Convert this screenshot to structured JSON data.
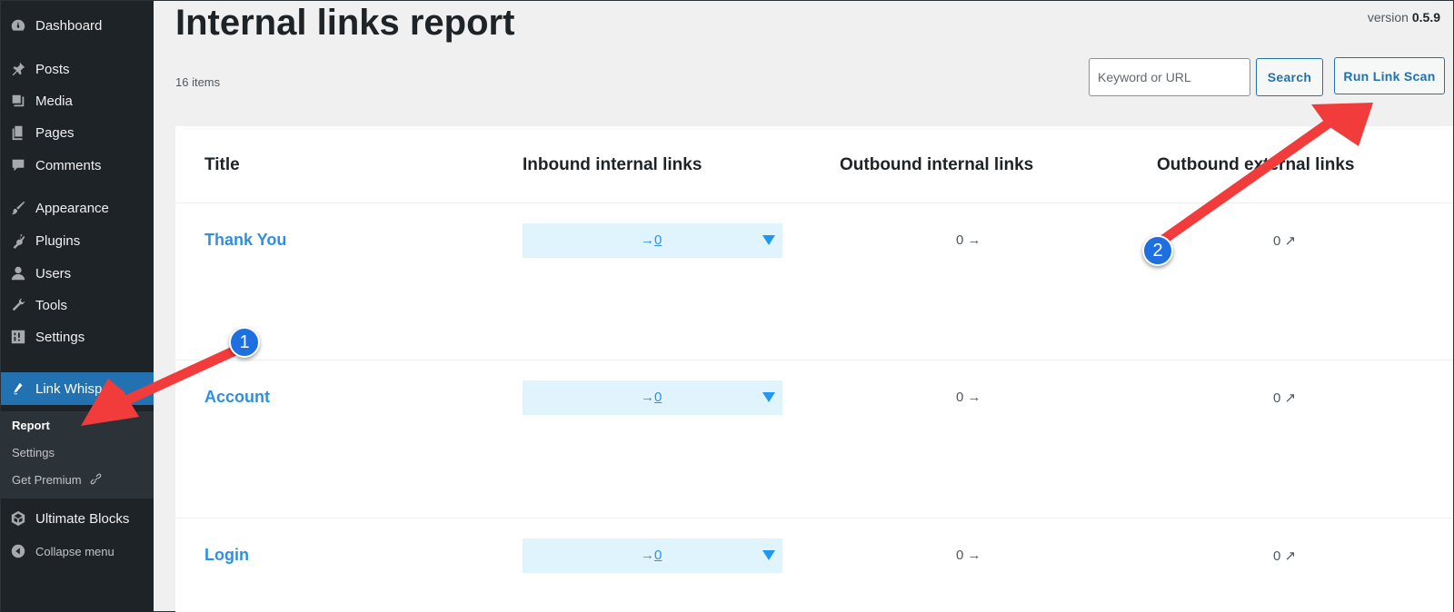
{
  "sidebar": {
    "items": [
      {
        "label": "Dashboard",
        "icon": "dashboard-icon"
      },
      {
        "label": "Posts",
        "icon": "pin-icon"
      },
      {
        "label": "Media",
        "icon": "media-icon"
      },
      {
        "label": "Pages",
        "icon": "pages-icon"
      },
      {
        "label": "Comments",
        "icon": "comment-icon"
      },
      {
        "label": "Appearance",
        "icon": "brush-icon"
      },
      {
        "label": "Plugins",
        "icon": "plugin-icon"
      },
      {
        "label": "Users",
        "icon": "user-icon"
      },
      {
        "label": "Tools",
        "icon": "wrench-icon"
      },
      {
        "label": "Settings",
        "icon": "settings-icon"
      },
      {
        "label": "Link Whisper",
        "icon": "link-whisper-icon"
      },
      {
        "label": "Ultimate Blocks",
        "icon": "blocks-icon"
      },
      {
        "label": "Collapse menu",
        "icon": "collapse-icon"
      }
    ],
    "submenu": [
      {
        "label": "Report"
      },
      {
        "label": "Settings"
      },
      {
        "label": "Get Premium"
      }
    ]
  },
  "page": {
    "title": "Internal links report",
    "version_label": "version",
    "version_number": "0.5.9",
    "items_count": "16 items"
  },
  "search": {
    "placeholder": "Keyword or URL",
    "value": "",
    "button_label": "Search"
  },
  "scan": {
    "button_label": "Run Link Scan"
  },
  "table": {
    "headers": [
      "Title",
      "Inbound internal links",
      "Outbound internal links",
      "Outbound external links"
    ],
    "rows": [
      {
        "title": "Thank You",
        "inbound": "0",
        "outbound_internal": "0",
        "outbound_external": "0"
      },
      {
        "title": "Account",
        "inbound": "0",
        "outbound_internal": "0",
        "outbound_external": "0"
      },
      {
        "title": "Login",
        "inbound": "0",
        "outbound_internal": "0",
        "outbound_external": "0"
      }
    ]
  },
  "annotations": {
    "badge_1": "1",
    "badge_2": "2",
    "arrow_color": "#f23b3b"
  },
  "colors": {
    "sidebar_bg": "#1d2327",
    "active_menu": "#2271b1",
    "link_blue": "#2f8fe4",
    "inbound_bg": "#dff4fc"
  }
}
